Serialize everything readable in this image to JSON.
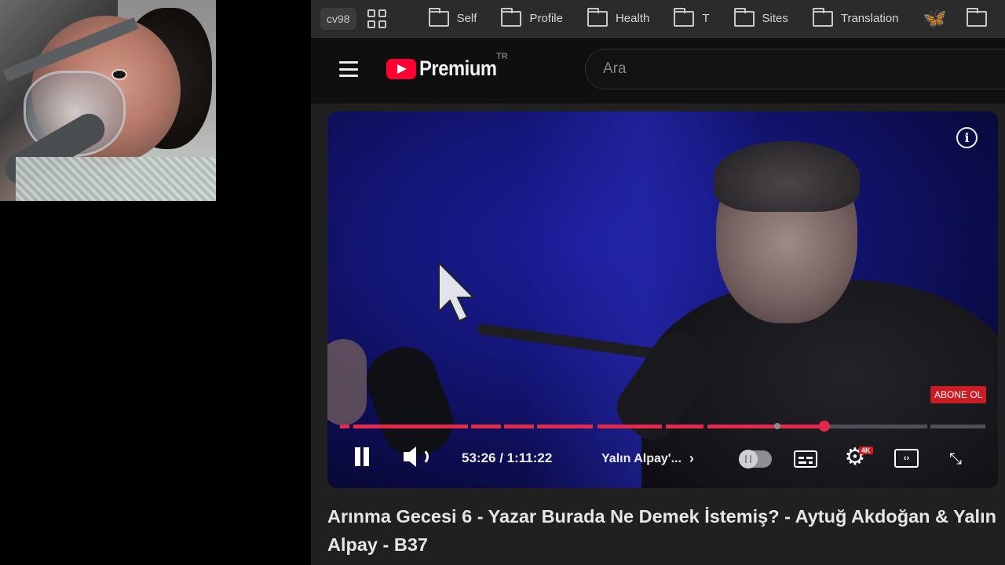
{
  "bookmarks_bar": {
    "profile_chip": "cv98",
    "folders": [
      {
        "label": "Self"
      },
      {
        "label": "Profile"
      },
      {
        "label": "Health"
      },
      {
        "label": "T"
      },
      {
        "label": "Sites"
      },
      {
        "label": "Translation"
      }
    ],
    "bluesky_color": "#1185fe"
  },
  "youtube": {
    "logo_text": "Premium",
    "logo_country": "TR",
    "brand_color": "#ff0033",
    "search_placeholder": "Ara"
  },
  "player": {
    "info_glyph": "i",
    "subscribe_badge": "ABONE OL",
    "progress_fraction": 0.751,
    "time_display": "53:26 / 1:11:22",
    "current_time": "53:26",
    "duration": "1:11:22",
    "chapter_label": "Yalın Alpay'...",
    "chapter_chevron": "›",
    "settings_badge": "4K",
    "accent_color": "#e5294b"
  },
  "video": {
    "title": "Arınma Gecesi 6 - Yazar Burada Ne Demek İstemiş? - Aytuğ Akdoğan & Yalın Alpay - B37"
  }
}
